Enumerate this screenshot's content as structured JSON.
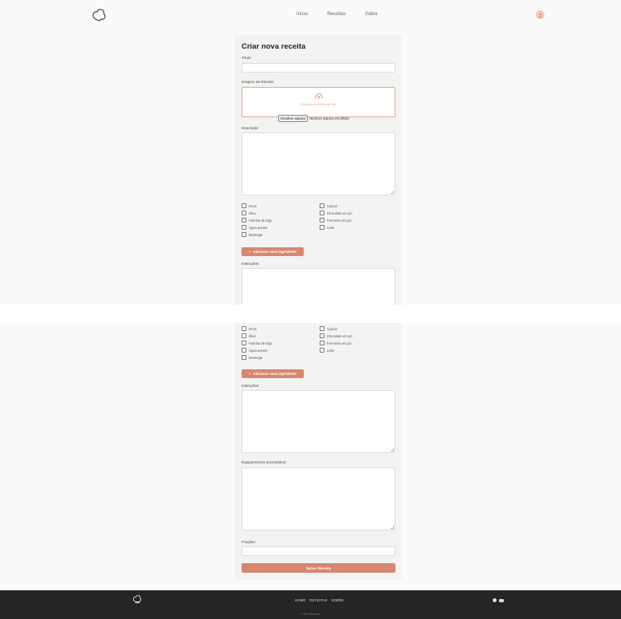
{
  "nav": {
    "links": [
      "Início",
      "Receitas",
      "Sobre"
    ]
  },
  "form": {
    "title": "Criar nova receita",
    "labels": {
      "title": "Título:",
      "image": "Imagem da Receita",
      "description": "Descrição:",
      "instructions": "Instruções:",
      "equipment": "Equipamentos necessários:",
      "portions": "Porções:"
    },
    "upload_text": "Clique para adicionar foto",
    "file_button": "Escolher arquivo",
    "file_status": "Nenhum arquivo escolhido",
    "ingredients_left": [
      "Ovos",
      "Óleo",
      "Farinha de trigo",
      "Água quente",
      "Manteiga"
    ],
    "ingredients_right": [
      "Açúcar",
      "Chocolate em pó",
      "Fermento em pó",
      "Leite"
    ],
    "add_ingredient": "Adicionar novo ingrediente",
    "save_button": "Salvar Receita"
  },
  "footer": {
    "links": [
      "HOME",
      "RECEITAS",
      "SOBRE"
    ],
    "copyright": "© 2024 Receitas"
  },
  "colors": {
    "accent": "#d8876f",
    "footer_bg": "#252525"
  }
}
